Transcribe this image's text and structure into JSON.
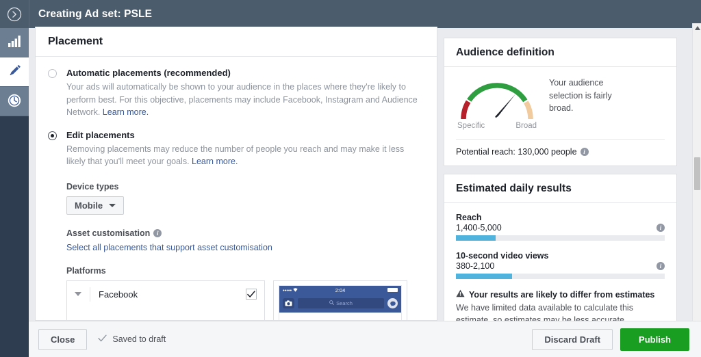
{
  "header": {
    "title": "Creating Ad set: PSLE",
    "collapse_icon": "chevron-right-circle-icon"
  },
  "sidebar": {
    "items": [
      {
        "icon": "bar-chart-icon",
        "active": false
      },
      {
        "icon": "pencil-icon",
        "active": true
      },
      {
        "icon": "clock-icon",
        "active": false
      }
    ]
  },
  "placement": {
    "card_title": "Placement",
    "options": [
      {
        "label": "Automatic placements (recommended)",
        "selected": false,
        "description": "Your ads will automatically be shown to your audience in the places where they're likely to perform best. For this objective, placements may include Facebook, Instagram and Audience Network. ",
        "link": "Learn more."
      },
      {
        "label": "Edit placements",
        "selected": true,
        "description": "Removing placements may reduce the number of people you reach and may make it less likely that you'll meet your goals. ",
        "link": "Learn more."
      }
    ],
    "device_types": {
      "label": "Device types",
      "value": "Mobile",
      "caret_icon": "caret-down-icon"
    },
    "asset_customisation": {
      "label": "Asset customisation",
      "info_icon": "info-icon",
      "link": "Select all placements that support asset customisation"
    },
    "platforms": {
      "label": "Platforms",
      "rows": [
        {
          "name": "Facebook",
          "checked": true,
          "collapse_icon": "triangle-down-icon",
          "check_icon": "check-icon"
        }
      ]
    },
    "preview": {
      "status_dots": "•••••",
      "wifi_icon": "wifi-icon",
      "time": "2:04",
      "battery_icon": "battery-icon",
      "camera_icon": "camera-icon",
      "search_icon": "search-icon",
      "search_placeholder": "Search",
      "messenger_icon": "messenger-icon"
    }
  },
  "audience": {
    "title": "Audience definition",
    "gauge": {
      "low_label": "Specific",
      "high_label": "Broad",
      "needle_angle_deg": 62,
      "colors": {
        "low": "#b5202a",
        "mid": "#2f9e41",
        "high": "#f1cb9d",
        "needle": "#1d2129"
      }
    },
    "message": "Your audience selection is fairly broad.",
    "potential_reach": "Potential reach: 130,000 people",
    "potential_reach_info_icon": "info-icon"
  },
  "estimated": {
    "title": "Estimated daily results",
    "metrics": [
      {
        "name": "Reach",
        "value": "1,400-5,000",
        "fill_percent": 19,
        "info_icon": "info-icon"
      },
      {
        "name": "10-second video views",
        "value": "380-2,100",
        "fill_percent": 27,
        "info_icon": "info-icon"
      }
    ],
    "warning": {
      "icon": "warning-triangle-icon",
      "title": "Your results are likely to differ from estimates",
      "body": "We have limited data available to calculate this estimate, so estimates may be less accurate."
    },
    "bar_color": "#4fb3dd"
  },
  "footer": {
    "close_label": "Close",
    "saved_label": "Saved to draft",
    "saved_icon": "check-icon",
    "discard_label": "Discard Draft",
    "publish_label": "Publish",
    "publish_color": "#1a9e22"
  },
  "scrollbars": {
    "up_icon": "triangle-up-icon",
    "down_icon": "triangle-down-icon"
  }
}
